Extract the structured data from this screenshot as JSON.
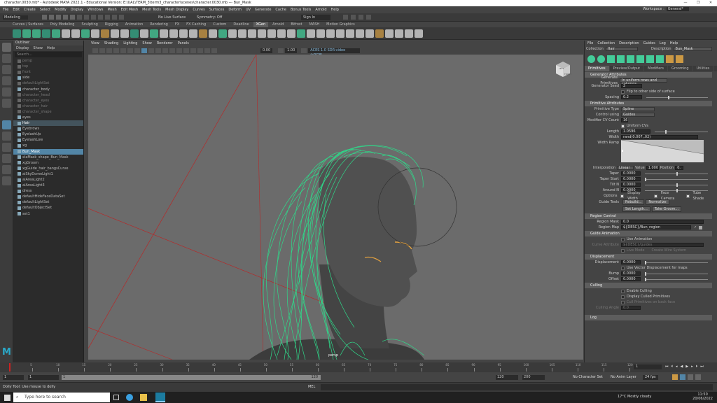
{
  "window": {
    "title": "character.0030.mb* - Autodesk MAYA 2022.1 - Educational Version: E:\\UAL\\TERM_3\\term3_character\\scenes\\character.0030.mb  ---  Bun_Mask",
    "buttons": [
      "—",
      "❐",
      "✕"
    ]
  },
  "menubar": [
    "File",
    "Edit",
    "Create",
    "Select",
    "Modify",
    "Display",
    "Windows",
    "Mesh",
    "Edit Mesh",
    "Mesh Tools",
    "Mesh Display",
    "Curves",
    "Surfaces",
    "Deform",
    "UV",
    "Generate",
    "Cache",
    "Bonus Tools",
    "Arnold",
    "Help"
  ],
  "workspace": {
    "label": "Workspace :",
    "value": "General*"
  },
  "status": {
    "mode": "Modeling",
    "no_live": "No Live Surface",
    "symmetry": "Symmetry: Off",
    "signin": "Sign In"
  },
  "shelf_tabs": [
    "Curves / Surfaces",
    "Poly Modeling",
    "Sculpting",
    "Rigging",
    "Animation",
    "Rendering",
    "FX",
    "FX Caching",
    "Custom",
    "Deadline",
    "XGen",
    "Arnold",
    "Bifrost",
    "MASH",
    "Motion Graphics"
  ],
  "shelf_active": "XGen",
  "outliner": {
    "title": "Outliner",
    "menu": [
      "Display",
      "Show",
      "Help"
    ],
    "search_placeholder": "Search...",
    "items": [
      {
        "label": "persp",
        "dim": true
      },
      {
        "label": "top",
        "dim": true
      },
      {
        "label": "front",
        "dim": true
      },
      {
        "label": "side",
        "dim": false
      },
      {
        "label": "defaultLightSet",
        "dim": true
      },
      {
        "label": "character_body",
        "dim": false
      },
      {
        "label": "character_head",
        "dim": true
      },
      {
        "label": "character_eyes",
        "dim": true
      },
      {
        "label": "character_hair",
        "dim": true
      },
      {
        "label": "character_shape",
        "dim": true
      },
      {
        "label": "eyes",
        "dim": false
      },
      {
        "label": "Hair",
        "dim": false,
        "hl": true
      },
      {
        "label": "Eyebrows",
        "dim": false
      },
      {
        "label": "EyelashUp",
        "dim": false
      },
      {
        "label": "EyelashLow",
        "dim": false
      },
      {
        "label": "xg",
        "dim": false
      },
      {
        "label": "Bun_Mask",
        "dim": false,
        "sel": true
      },
      {
        "label": "xlaMask_shape_Bun_Mask",
        "dim": false
      },
      {
        "label": "xgGroom",
        "dim": false
      },
      {
        "label": "xgGuide_hair_bangsCurve",
        "dim": false
      },
      {
        "label": "aiSkyDomeLight1",
        "dim": false
      },
      {
        "label": "aiAreaLight2",
        "dim": false
      },
      {
        "label": "aiAreaLight3",
        "dim": false
      },
      {
        "label": "dress",
        "dim": false
      },
      {
        "label": "defaultHideFaceDataSet",
        "dim": false
      },
      {
        "label": "defaultLightSet",
        "dim": false
      },
      {
        "label": "defaultObjectSet",
        "dim": false
      },
      {
        "label": "set1",
        "dim": false
      }
    ]
  },
  "viewport": {
    "menu": [
      "View",
      "Shading",
      "Lighting",
      "Show",
      "Renderer",
      "Panels"
    ],
    "field1": "0.00",
    "field2": "1.00",
    "colorspace": "ACES 1.0 SDR-video (sRGB)",
    "camera_label": "persp",
    "cube_labels": [
      "LEFT",
      "FRONT"
    ]
  },
  "attr": {
    "menu": [
      "File",
      "Collection",
      "Description",
      "Guides",
      "Log",
      "Help"
    ],
    "collection_label": "Collection",
    "collection_value": "Hair",
    "description_label": "Description",
    "description_value": "Bun_Mask",
    "tabs": [
      "Primitives",
      "Preview/Output",
      "Modifiers",
      "Grooming",
      "Utilities",
      "Expressions"
    ],
    "sections": {
      "generator": "Generator Attributes",
      "primitive": "Primitive Attributes",
      "region": "Region Control",
      "guide_anim": "Guide Animation",
      "displacement": "Displacement",
      "culling": "Culling",
      "log": "Log"
    },
    "gen_primitives_label": "Generate Primitives",
    "gen_primitives_value": "In uniform rows and columns",
    "gen_seed_label": "Generator Seed",
    "gen_seed_value": "2",
    "flip_label": "Flip to other side of surface",
    "spacing_label": "Spacing",
    "spacing_value": "0.2",
    "prim_type_label": "Primitive Type",
    "prim_type_value": "Spline",
    "control_label": "Control using",
    "control_value": "Guides",
    "cv_count_label": "Modifier CV Count",
    "cv_count_value": "16",
    "uniform_label": "Uniform CVs",
    "length_label": "Length",
    "length_value": "1.0596",
    "width_label": "Width",
    "width_value": "rand(0.007,.02)",
    "width_ramp_label": "Width Ramp",
    "interp_label": "Interpolation",
    "interp_value": "Linear",
    "value_label": "Value",
    "value_value": "1.000",
    "position_label": "Position",
    "position_value": "0.",
    "taper_label": "Taper",
    "taper_value": "0.0000",
    "taper_start_label": "Taper Start",
    "taper_start_value": "0.0000",
    "tilt_n_label": "Tilt N",
    "tilt_n_value": "0.0000",
    "around_n_label": "Around N",
    "around_n_value": "0.0000",
    "options_label": "Options",
    "display_width": "Display Width",
    "face_camera": "Face Camera",
    "tube_shade": "Tube Shade",
    "guide_tools_label": "Guide Tools",
    "rebuild": "Rebuild...",
    "normalize": "Normalize",
    "set_length": "Set Length...",
    "take_groom": "Take Groom...",
    "region_mask_label": "Region Mask",
    "region_mask_value": "0.0",
    "region_map_label": "Region Map",
    "region_map_value": "${DESC}/Bun_region",
    "use_anim": "Use Animation",
    "curve_label": "Curve Attribute",
    "curve_value": "${DESC}/guides",
    "live_mode": "Live Mode",
    "create_anim": "Create Wire System",
    "displacement_label": "Displacement",
    "displacement_value": "0.0000",
    "use_vector": "Use Vector Displacement for maps",
    "bump_label": "Bump",
    "bump_value": "0.0000",
    "offset_label": "Offset",
    "offset_value": "0.0000",
    "enable_culling": "Enable Culling",
    "display_culled": "Display Culled Primitives",
    "cull_flag": "Cull Primitives on back face",
    "culling_angle_label": "Culling Angle",
    "culling_angle_value": "0.0"
  },
  "timeline": {
    "ticks": [
      "5",
      "10",
      "15",
      "20",
      "25",
      "30",
      "35",
      "40",
      "45",
      "50",
      "55",
      "60",
      "65",
      "70",
      "75",
      "80",
      "85",
      "90",
      "95",
      "100",
      "105",
      "110",
      "115",
      "120"
    ],
    "current_frame": "1",
    "range_start": "1",
    "range_inner_start": "1",
    "range_inner_end": "120",
    "range_end": "120",
    "end2": "200",
    "char_set": "No Character Set",
    "anim_layer": "No Anim Layer",
    "fps": "24 fps"
  },
  "cmdline": {
    "mel": "MEL",
    "help": "Dolly Tool: Use mouse to dolly"
  },
  "taskbar": {
    "search": "Type here to search",
    "weather": "17°C  Mostly cloudy",
    "time": "11:50",
    "date": "20/06/2022"
  }
}
